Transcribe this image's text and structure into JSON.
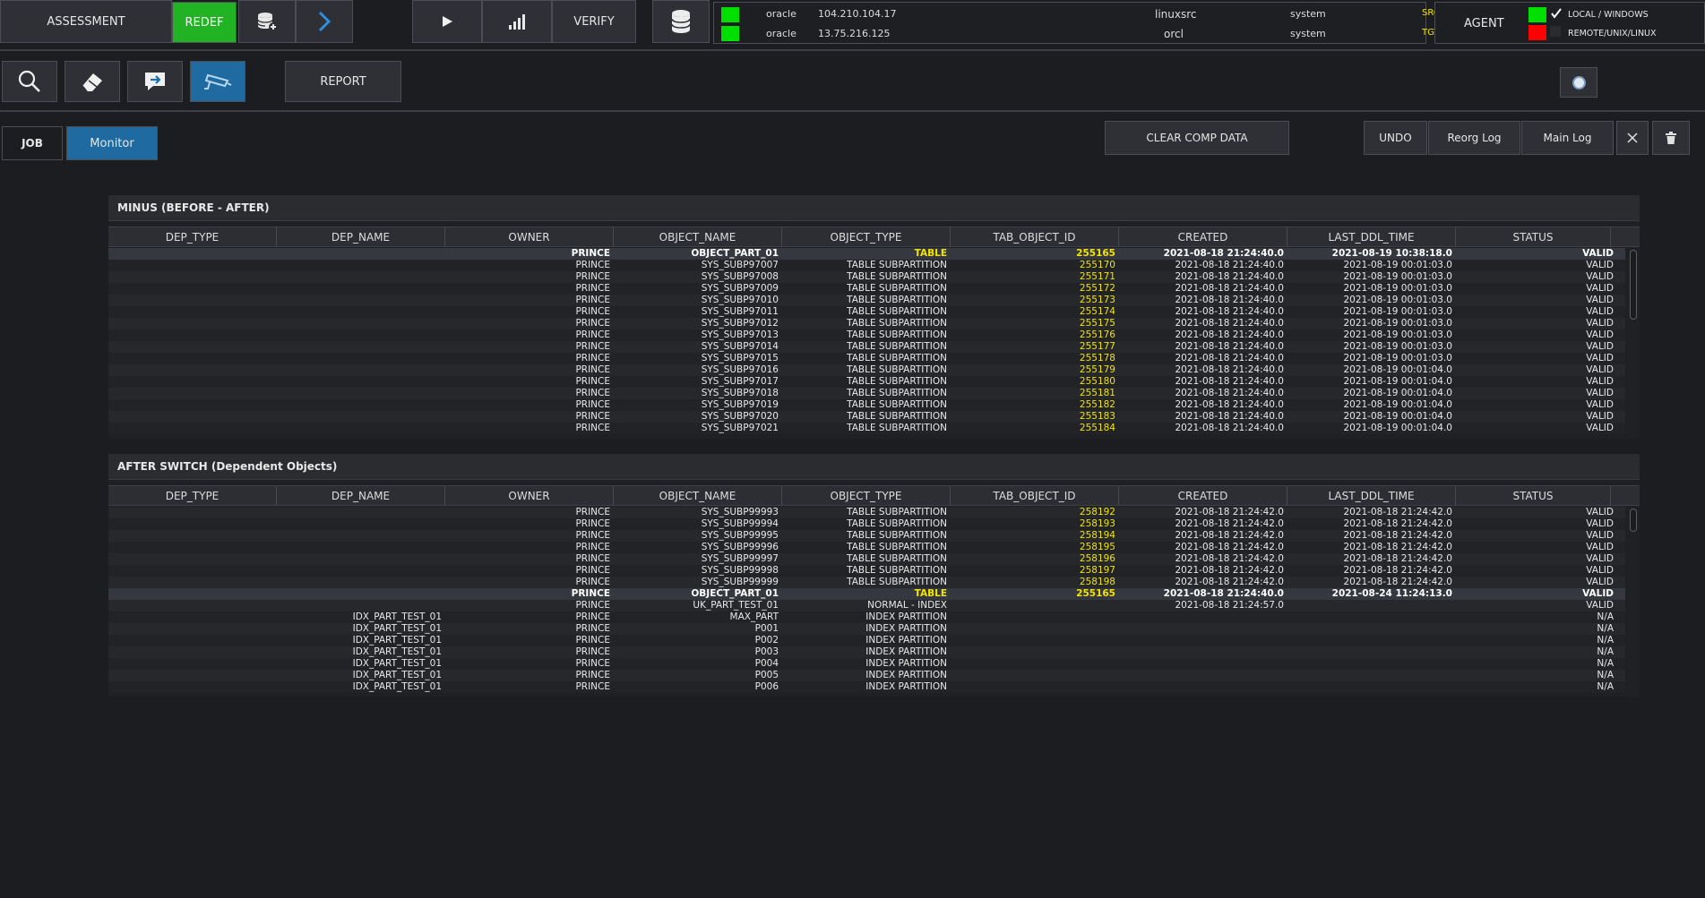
{
  "toolbar": {
    "assessment": "ASSESSMENT",
    "redef": "REDEF",
    "verify": "VERIFY",
    "report": "REPORT"
  },
  "connections": [
    {
      "user": "oracle",
      "ip": "104.210.104.17",
      "db": "linuxsrc",
      "schema": "system",
      "role": "SRC",
      "status_color": "#00e000"
    },
    {
      "user": "oracle",
      "ip": "13.75.216.125",
      "db": "orcl",
      "schema": "system",
      "role": "TGT",
      "status_color": "#00e000"
    }
  ],
  "agent": {
    "label": "AGENT",
    "local": "LOCAL / WINDOWS",
    "remote": "REMOTE/UNIX/LINUX",
    "local_color": "#00e000",
    "remote_color": "#ff0000"
  },
  "tabs": {
    "job": "JOB",
    "monitor": "Monitor"
  },
  "actions": {
    "clear_comp": "CLEAR COMP DATA",
    "undo": "UNDO",
    "reorg_log": "Reorg Log",
    "main_log": "Main Log"
  },
  "columns": [
    "DEP_TYPE",
    "DEP_NAME",
    "OWNER",
    "OBJECT_NAME",
    "OBJECT_TYPE",
    "TAB_OBJECT_ID",
    "CREATED",
    "LAST_DDL_TIME",
    "STATUS"
  ],
  "minus": {
    "title": "MINUS (BEFORE - AFTER)",
    "rows": [
      [
        "",
        "",
        "PRINCE",
        "OBJECT_PART_01",
        "TABLE",
        "255165",
        "2021-08-18 21:24:40.0",
        "2021-08-19 10:38:18.0",
        "VALID"
      ],
      [
        "",
        "",
        "PRINCE",
        "SYS_SUBP97007",
        "TABLE SUBPARTITION",
        "255170",
        "2021-08-18 21:24:40.0",
        "2021-08-19 00:01:03.0",
        "VALID"
      ],
      [
        "",
        "",
        "PRINCE",
        "SYS_SUBP97008",
        "TABLE SUBPARTITION",
        "255171",
        "2021-08-18 21:24:40.0",
        "2021-08-19 00:01:03.0",
        "VALID"
      ],
      [
        "",
        "",
        "PRINCE",
        "SYS_SUBP97009",
        "TABLE SUBPARTITION",
        "255172",
        "2021-08-18 21:24:40.0",
        "2021-08-19 00:01:03.0",
        "VALID"
      ],
      [
        "",
        "",
        "PRINCE",
        "SYS_SUBP97010",
        "TABLE SUBPARTITION",
        "255173",
        "2021-08-18 21:24:40.0",
        "2021-08-19 00:01:03.0",
        "VALID"
      ],
      [
        "",
        "",
        "PRINCE",
        "SYS_SUBP97011",
        "TABLE SUBPARTITION",
        "255174",
        "2021-08-18 21:24:40.0",
        "2021-08-19 00:01:03.0",
        "VALID"
      ],
      [
        "",
        "",
        "PRINCE",
        "SYS_SUBP97012",
        "TABLE SUBPARTITION",
        "255175",
        "2021-08-18 21:24:40.0",
        "2021-08-19 00:01:03.0",
        "VALID"
      ],
      [
        "",
        "",
        "PRINCE",
        "SYS_SUBP97013",
        "TABLE SUBPARTITION",
        "255176",
        "2021-08-18 21:24:40.0",
        "2021-08-19 00:01:03.0",
        "VALID"
      ],
      [
        "",
        "",
        "PRINCE",
        "SYS_SUBP97014",
        "TABLE SUBPARTITION",
        "255177",
        "2021-08-18 21:24:40.0",
        "2021-08-19 00:01:03.0",
        "VALID"
      ],
      [
        "",
        "",
        "PRINCE",
        "SYS_SUBP97015",
        "TABLE SUBPARTITION",
        "255178",
        "2021-08-18 21:24:40.0",
        "2021-08-19 00:01:03.0",
        "VALID"
      ],
      [
        "",
        "",
        "PRINCE",
        "SYS_SUBP97016",
        "TABLE SUBPARTITION",
        "255179",
        "2021-08-18 21:24:40.0",
        "2021-08-19 00:01:04.0",
        "VALID"
      ],
      [
        "",
        "",
        "PRINCE",
        "SYS_SUBP97017",
        "TABLE SUBPARTITION",
        "255180",
        "2021-08-18 21:24:40.0",
        "2021-08-19 00:01:04.0",
        "VALID"
      ],
      [
        "",
        "",
        "PRINCE",
        "SYS_SUBP97018",
        "TABLE SUBPARTITION",
        "255181",
        "2021-08-18 21:24:40.0",
        "2021-08-19 00:01:04.0",
        "VALID"
      ],
      [
        "",
        "",
        "PRINCE",
        "SYS_SUBP97019",
        "TABLE SUBPARTITION",
        "255182",
        "2021-08-18 21:24:40.0",
        "2021-08-19 00:01:04.0",
        "VALID"
      ],
      [
        "",
        "",
        "PRINCE",
        "SYS_SUBP97020",
        "TABLE SUBPARTITION",
        "255183",
        "2021-08-18 21:24:40.0",
        "2021-08-19 00:01:04.0",
        "VALID"
      ],
      [
        "",
        "",
        "PRINCE",
        "SYS_SUBP97021",
        "TABLE SUBPARTITION",
        "255184",
        "2021-08-18 21:24:40.0",
        "2021-08-19 00:01:04.0",
        "VALID"
      ]
    ]
  },
  "after": {
    "title": "AFTER SWITCH (Dependent Objects)",
    "rows": [
      [
        "",
        "",
        "PRINCE",
        "SYS_SUBP99993",
        "TABLE SUBPARTITION",
        "258192",
        "2021-08-18 21:24:42.0",
        "2021-08-18 21:24:42.0",
        "VALID"
      ],
      [
        "",
        "",
        "PRINCE",
        "SYS_SUBP99994",
        "TABLE SUBPARTITION",
        "258193",
        "2021-08-18 21:24:42.0",
        "2021-08-18 21:24:42.0",
        "VALID"
      ],
      [
        "",
        "",
        "PRINCE",
        "SYS_SUBP99995",
        "TABLE SUBPARTITION",
        "258194",
        "2021-08-18 21:24:42.0",
        "2021-08-18 21:24:42.0",
        "VALID"
      ],
      [
        "",
        "",
        "PRINCE",
        "SYS_SUBP99996",
        "TABLE SUBPARTITION",
        "258195",
        "2021-08-18 21:24:42.0",
        "2021-08-18 21:24:42.0",
        "VALID"
      ],
      [
        "",
        "",
        "PRINCE",
        "SYS_SUBP99997",
        "TABLE SUBPARTITION",
        "258196",
        "2021-08-18 21:24:42.0",
        "2021-08-18 21:24:42.0",
        "VALID"
      ],
      [
        "",
        "",
        "PRINCE",
        "SYS_SUBP99998",
        "TABLE SUBPARTITION",
        "258197",
        "2021-08-18 21:24:42.0",
        "2021-08-18 21:24:42.0",
        "VALID"
      ],
      [
        "",
        "",
        "PRINCE",
        "SYS_SUBP99999",
        "TABLE SUBPARTITION",
        "258198",
        "2021-08-18 21:24:42.0",
        "2021-08-18 21:24:42.0",
        "VALID"
      ],
      [
        "",
        "",
        "PRINCE",
        "OBJECT_PART_01",
        "TABLE",
        "255165",
        "2021-08-18 21:24:40.0",
        "2021-08-24 11:24:13.0",
        "VALID"
      ],
      [
        "",
        "",
        "PRINCE",
        "UK_PART_TEST_01",
        "NORMAL - INDEX",
        "",
        "2021-08-18 21:24:57.0",
        "",
        "VALID"
      ],
      [
        "",
        "IDX_PART_TEST_01",
        "PRINCE",
        "MAX_PART",
        "INDEX PARTITION",
        "",
        "",
        "",
        "N/A"
      ],
      [
        "",
        "IDX_PART_TEST_01",
        "PRINCE",
        "P001",
        "INDEX PARTITION",
        "",
        "",
        "",
        "N/A"
      ],
      [
        "",
        "IDX_PART_TEST_01",
        "PRINCE",
        "P002",
        "INDEX PARTITION",
        "",
        "",
        "",
        "N/A"
      ],
      [
        "",
        "IDX_PART_TEST_01",
        "PRINCE",
        "P003",
        "INDEX PARTITION",
        "",
        "",
        "",
        "N/A"
      ],
      [
        "",
        "IDX_PART_TEST_01",
        "PRINCE",
        "P004",
        "INDEX PARTITION",
        "",
        "",
        "",
        "N/A"
      ],
      [
        "",
        "IDX_PART_TEST_01",
        "PRINCE",
        "P005",
        "INDEX PARTITION",
        "",
        "",
        "",
        "N/A"
      ],
      [
        "",
        "IDX_PART_TEST_01",
        "PRINCE",
        "P006",
        "INDEX PARTITION",
        "",
        "",
        "",
        "N/A"
      ]
    ]
  },
  "colors": {
    "accent_green": "#22b324",
    "accent_blue": "#1f6fa8",
    "id_yellow": "#f2e400"
  }
}
